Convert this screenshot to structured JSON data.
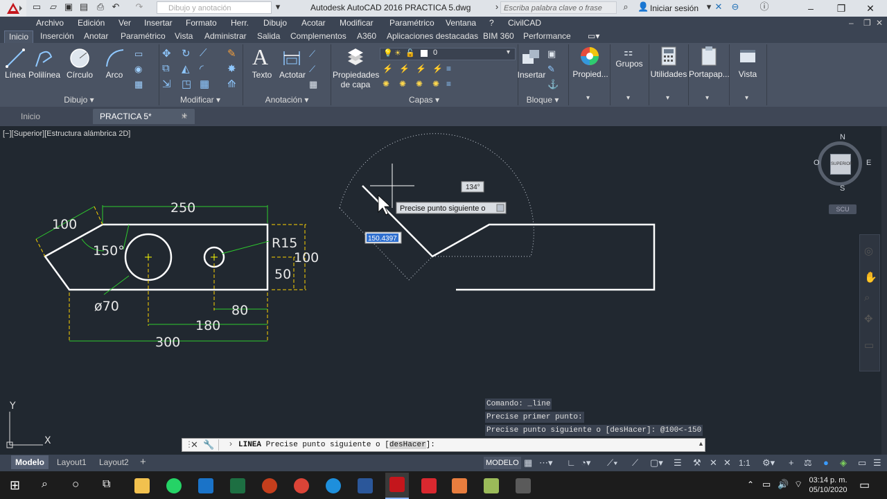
{
  "app": {
    "title": "Autodesk AutoCAD 2016    PRACTICA 5.dwg",
    "workspace_placeholder": "Dibujo y anotación",
    "search_placeholder": "Escriba palabra clave o frase",
    "signin": "Iniciar sesión"
  },
  "menu": [
    "Archivo",
    "Edición",
    "Ver",
    "Insertar",
    "Formato",
    "Herr.",
    "Dibujo",
    "Acotar",
    "Modificar",
    "Paramétrico",
    "Ventana",
    "?",
    "CivilCAD"
  ],
  "ribbon_tabs": [
    "Inicio",
    "Inserción",
    "Anotar",
    "Paramétrico",
    "Vista",
    "Administrar",
    "Salida",
    "Complementos",
    "A360",
    "Aplicaciones destacadas",
    "BIM 360",
    "Performance"
  ],
  "tools": {
    "linea": "Línea",
    "polilinea": "Polilínea",
    "circulo": "Círculo",
    "arco": "Arco",
    "texto": "Texto",
    "acotar": "Actotar",
    "propiedades_capa_1": "Propiedades",
    "propiedades_capa_2": "de capa",
    "capa_actual": "0",
    "insertar": "Insertar",
    "propied": "Propied...",
    "grupos": "Grupos",
    "utilidades": "Utilidades",
    "portapap": "Portapap...",
    "vista": "Vista"
  },
  "panels": [
    "Dibujo",
    "Modificar",
    "Anotación",
    "Capas",
    "Bloque"
  ],
  "file_tabs": [
    "Inicio",
    "PRACTICA 5*"
  ],
  "viewport_label": "[−][Superior][Estructura alámbrica 2D]",
  "viewcube": {
    "n": "N",
    "s": "S",
    "e": "E",
    "o": "O",
    "face": "SUPERIOR",
    "ucs": "SCU"
  },
  "dims": {
    "d250": "250",
    "d100_left": "100",
    "d150": "150°",
    "r15": "R15",
    "d100_right": "100",
    "d50": "50",
    "d70": "ø70",
    "d80": "80",
    "d180": "180",
    "d300": "300"
  },
  "dynamic_input": {
    "angle": "134°",
    "prompt": "Precise punto siguiente o",
    "length": "150.4397"
  },
  "history": [
    "Comando: _line",
    "Precise primer punto:",
    "Precise punto siguiente o [desHacer]: @100<-150"
  ],
  "command": {
    "prefix": "LINEA",
    "text": "Precise punto siguiente o [",
    "keyword": "desHacer",
    "suffix": "]:"
  },
  "layout_tabs": [
    "Modelo",
    "Layout1",
    "Layout2"
  ],
  "status": {
    "model": "MODELO",
    "scale": "1:1"
  },
  "clock": {
    "time": "03:14 p. m.",
    "date": "05/10/2020"
  },
  "ucs_icon": {
    "x": "X",
    "y": "Y"
  }
}
